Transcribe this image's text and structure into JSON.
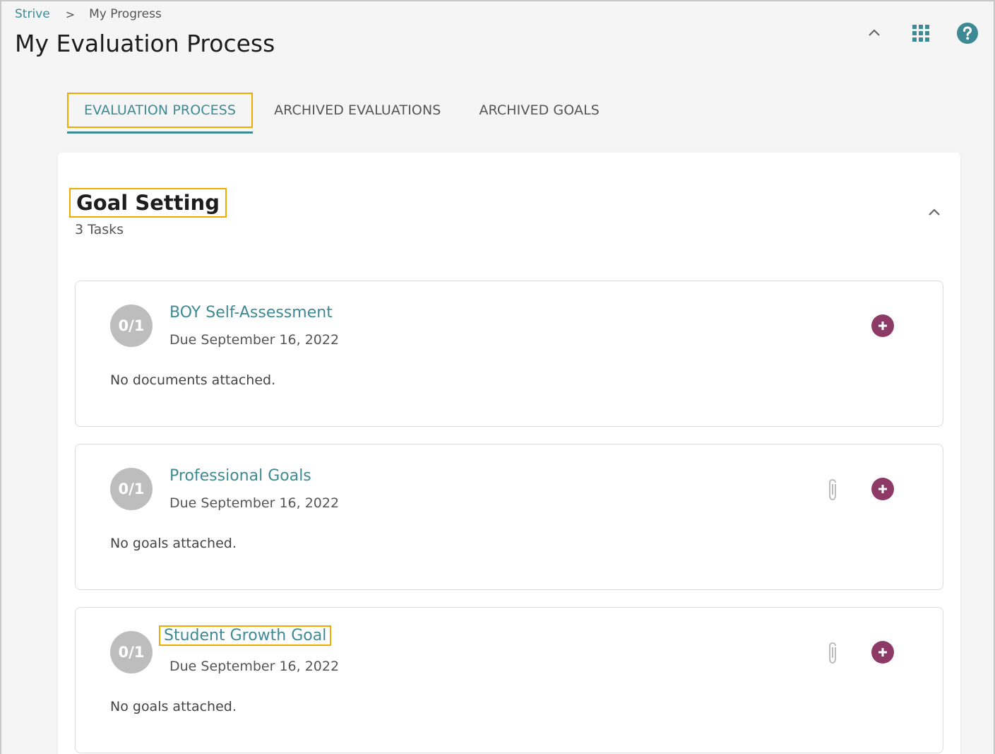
{
  "breadcrumb": {
    "root": "Strive",
    "separator": ">",
    "current": "My Progress"
  },
  "page": {
    "title": "My Evaluation Process"
  },
  "header_icons": [
    "chevron-up-icon",
    "apps-grid-icon",
    "help-icon"
  ],
  "tabs": [
    {
      "label": "EVALUATION PROCESS",
      "active": true
    },
    {
      "label": "ARCHIVED EVALUATIONS",
      "active": false
    },
    {
      "label": "ARCHIVED GOALS",
      "active": false
    }
  ],
  "section": {
    "title": "Goal Setting",
    "subtitle": "3 Tasks",
    "tasks": [
      {
        "progress": "0/1",
        "title": "BOY Self-Assessment",
        "due": "Due September 16, 2022",
        "note": "No documents attached.",
        "has_attachment_icon": false
      },
      {
        "progress": "0/1",
        "title": "Professional Goals",
        "due": "Due September 16, 2022",
        "note": "No goals attached.",
        "has_attachment_icon": true
      },
      {
        "progress": "0/1",
        "title": "Student Growth Goal",
        "due": "Due September 16, 2022",
        "note": "No goals attached.",
        "has_attachment_icon": true
      }
    ]
  },
  "colors": {
    "accent": "#3d8a94",
    "add_button": "#8e3a66",
    "highlight": "#f2a900",
    "progress_circle": "#bdbdbd"
  }
}
